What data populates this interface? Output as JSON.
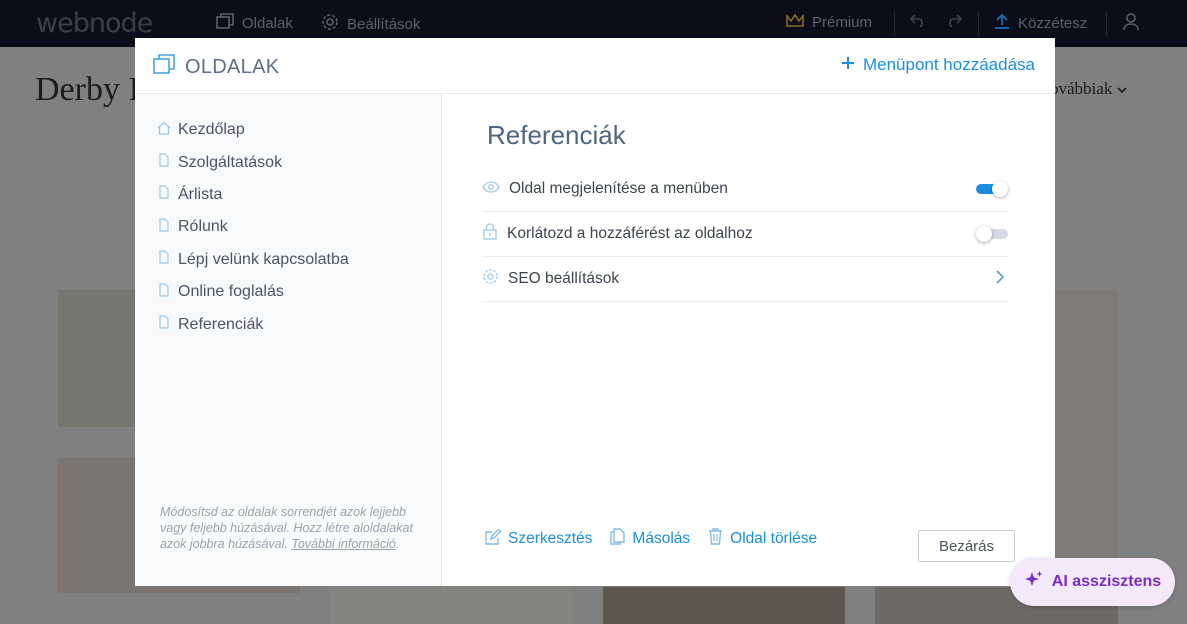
{
  "topbar": {
    "logo": "webnode",
    "pages_label": "Oldalak",
    "settings_label": "Beállítások",
    "premium_label": "Prémium",
    "publish_label": "Közzétesz"
  },
  "site": {
    "title": "Derby I",
    "more_label": "ovábbiak"
  },
  "modal": {
    "title": "OLDALAK",
    "add_item_label": "Menüpont hozzáadása",
    "pages": [
      {
        "label": "Kezdőlap",
        "icon": "home-icon"
      },
      {
        "label": "Szolgáltatások",
        "icon": "page-icon"
      },
      {
        "label": "Árlista",
        "icon": "page-icon"
      },
      {
        "label": "Rólunk",
        "icon": "page-icon"
      },
      {
        "label": "Lépj velünk kapcsolatba",
        "icon": "page-icon"
      },
      {
        "label": "Online foglalás",
        "icon": "page-icon"
      },
      {
        "label": "Referenciák",
        "icon": "page-icon"
      }
    ],
    "hint_text": "Módosítsd az oldalak sorrendjét azok lejjebb vagy feljebb húzásával. Hozz létre aloldalakat azok jobbra húzásával.",
    "hint_link": "További információ",
    "hint_suffix": ".",
    "selected_page": "Referenciák",
    "settings": [
      {
        "label": "Oldal megjelenítése a menüben",
        "icon": "eye-icon",
        "toggle": true
      },
      {
        "label": "Korlátozd a hozzáférést az oldalhoz",
        "icon": "lock-icon",
        "toggle": false
      },
      {
        "label": "SEO beállítások",
        "icon": "gear-icon"
      }
    ],
    "actions": {
      "edit_label": "Szerkesztés",
      "copy_label": "Másolás",
      "delete_label": "Oldal törlése",
      "close_label": "Bezárás"
    }
  },
  "ai_assistant_label": "AI asszisztens",
  "colors": {
    "accent": "#1a8ee0",
    "ai_purple": "#7a2fc3",
    "topbar_bg": "#0b0e1a",
    "toggle_on": "#1a8ee0",
    "toggle_off": "#d6dae8"
  }
}
